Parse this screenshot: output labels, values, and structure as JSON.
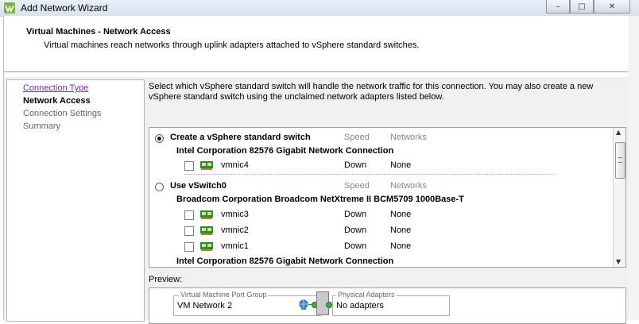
{
  "window": {
    "title": "Add Network Wizard",
    "buttons": {
      "minimize": "–",
      "maximize": "□",
      "close": "✕"
    }
  },
  "header": {
    "title": "Virtual Machines - Network Access",
    "description": "Virtual machines reach networks through uplink adapters attached to vSphere standard switches."
  },
  "steps": [
    {
      "label": "Connection Type",
      "state": "link"
    },
    {
      "label": "Network Access",
      "state": "current"
    },
    {
      "label": "Connection Settings",
      "state": "muted"
    },
    {
      "label": "Summary",
      "state": "muted"
    }
  ],
  "instruction": "Select which vSphere standard switch will handle the network traffic for this connection. You may also create a new vSphere standard switch using the unclaimed network adapters listed below.",
  "list": {
    "speed_header": "Speed",
    "networks_header": "Networks",
    "options": [
      {
        "label": "Create a vSphere standard switch",
        "selected": true,
        "groups": [
          {
            "adapter": "Intel Corporation 82576 Gigabit Network Connection",
            "nics": [
              {
                "name": "vmnic4",
                "speed": "Down",
                "networks": "None"
              }
            ]
          }
        ]
      },
      {
        "label": "Use vSwitch0",
        "selected": false,
        "groups": [
          {
            "adapter": "Broadcom Corporation Broadcom NetXtreme II BCM5709 1000Base-T",
            "nics": [
              {
                "name": "vmnic3",
                "speed": "Down",
                "networks": "None"
              },
              {
                "name": "vmnic2",
                "speed": "Down",
                "networks": "None"
              },
              {
                "name": "vmnic1",
                "speed": "Down",
                "networks": "None"
              }
            ]
          },
          {
            "adapter": "Intel Corporation 82576 Gigabit Network Connection",
            "nics": []
          }
        ]
      }
    ]
  },
  "preview": {
    "label": "Preview:",
    "port_group_caption": "Virtual Machine Port Group",
    "port_group_name": "VM Network 2",
    "physical_caption": "Physical Adapters",
    "physical_value": "No adapters"
  },
  "colors": {
    "link": "#7030a0",
    "nic_green": "#2e8b2e",
    "connector": "#3fae3f"
  }
}
